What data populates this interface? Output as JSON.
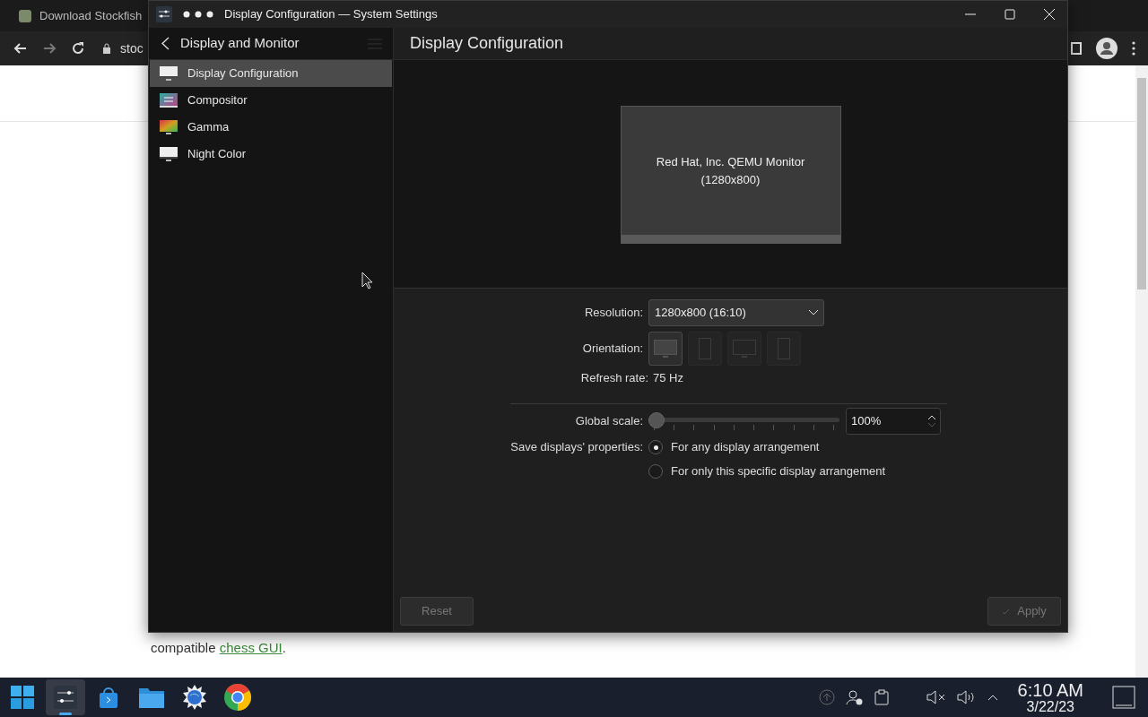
{
  "browser": {
    "tab_title": "Download Stockfish",
    "address": "stoc",
    "paragraph": {
      "before": "compatible ",
      "link": "chess GUI",
      "after": "."
    }
  },
  "window": {
    "title": "Display Configuration — System Settings"
  },
  "sidebar": {
    "header": "Display and Monitor",
    "items": [
      {
        "label": "Display Configuration",
        "kind": "monitor",
        "selected": true
      },
      {
        "label": "Compositor",
        "kind": "compositor",
        "selected": false
      },
      {
        "label": "Gamma",
        "kind": "gamma",
        "selected": false
      },
      {
        "label": "Night Color",
        "kind": "monitor",
        "selected": false
      }
    ]
  },
  "page": {
    "title": "Display Configuration",
    "monitor": {
      "name": "Red Hat, Inc. QEMU Monitor",
      "resolution": "(1280x800)"
    }
  },
  "form": {
    "resolution_label": "Resolution:",
    "resolution_value": "1280x800 (16:10)",
    "orientation_label": "Orientation:",
    "orientations": [
      {
        "kind": "landscape",
        "selected": true
      },
      {
        "kind": "portrait",
        "selected": false
      },
      {
        "kind": "landscape",
        "selected": false
      },
      {
        "kind": "portrait",
        "selected": false
      }
    ],
    "refresh_label": "Refresh rate:",
    "refresh_value": "75 Hz",
    "scale_label": "Global scale:",
    "scale_slider": {
      "level": 0
    },
    "scale_value": "100%",
    "save_label": "Save displays' properties:",
    "save_options": [
      {
        "label": "For any display arrangement",
        "selected": true
      },
      {
        "label": "For only this specific display arrangement",
        "selected": false
      }
    ]
  },
  "buttons": [
    {
      "kind": "reset",
      "label": "Reset",
      "disabled": true
    },
    {
      "kind": "apply",
      "label": "Apply",
      "disabled": true
    }
  ],
  "taskbar": {
    "apps": [
      {
        "kind": "start",
        "selected": false
      },
      {
        "kind": "settings",
        "selected": true
      },
      {
        "kind": "store",
        "selected": false
      },
      {
        "kind": "files",
        "selected": false
      },
      {
        "kind": "kde",
        "selected": false
      },
      {
        "kind": "chrome",
        "selected": false
      }
    ],
    "time": "6:10 AM",
    "date": "3/22/23"
  }
}
